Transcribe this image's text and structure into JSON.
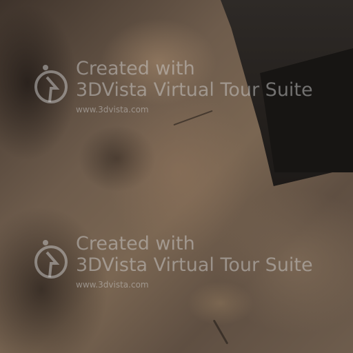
{
  "watermarks": [
    {
      "line1": "Created with",
      "line2": "3DVista Virtual Tour Suite",
      "url": "www.3dvista.com",
      "logo_icon": "3dvista-logo-icon"
    },
    {
      "line1": "Created with",
      "line2": "3DVista Virtual Tour Suite",
      "url": "www.3dvista.com",
      "logo_icon": "3dvista-logo-icon"
    }
  ],
  "colors": {
    "watermark_text": "#cdcdcd",
    "floor": "#6e5c4c",
    "shadow": "#1d1a18"
  }
}
